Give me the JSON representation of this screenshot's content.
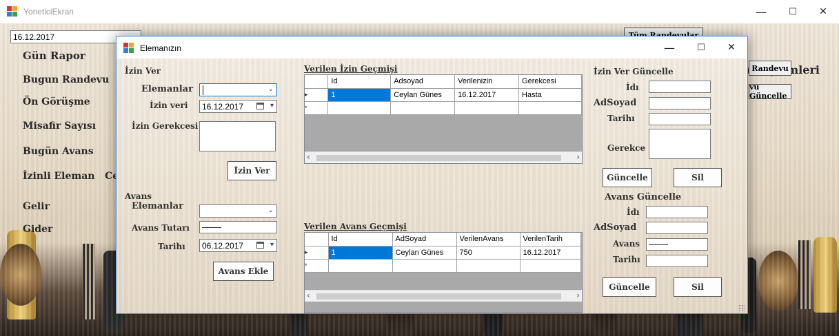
{
  "main_window": {
    "title": "YoneticiEkran",
    "minimize": "—",
    "maximize": "☐",
    "close": "✕",
    "date_value": "16.12.2017",
    "top_button": "Tüm Randevular",
    "right_heading": "vu İşlemleri",
    "right_button_1": "Randevu",
    "right_button_2": "vu Güncelle",
    "sidebar": [
      "Gün Rapor",
      "Bugun Randevu",
      "Ön Görüşme",
      "Misafir Sayısı",
      "Bugün Avans",
      "İzinli Eleman   Cey",
      "Gelir",
      "Gider"
    ]
  },
  "dialog": {
    "title": "Elemanızın",
    "minimize": "—",
    "maximize": "☐",
    "close": "✕",
    "izin": {
      "heading": "İzin Ver",
      "elemanlar_label": "Elemanlar",
      "elemanlar_value": "",
      "izin_veri_label": "İzin veri",
      "izin_veri_value": "16.12.2017",
      "gerekce_label": "İzin Gerekcesi",
      "gerekce_value": "",
      "button": "İzin Ver"
    },
    "avans": {
      "heading": "Avans",
      "elemanlar_label": "Elemanlar",
      "elemanlar_value": "",
      "tutar_label": "Avans Tutarı",
      "tutar_value": "",
      "tarih_label": "Tarihı",
      "tarih_value": "06.12.2017",
      "button": "Avans Ekle"
    },
    "izin_grid": {
      "title": "Verilen İzin Geçmişi",
      "columns": [
        "Id",
        "Adsoyad",
        "Verilenizin",
        "Gerekcesi"
      ],
      "rows": [
        [
          "1",
          "Ceylan Günes",
          "16.12.2017",
          "Hasta"
        ]
      ]
    },
    "avans_grid": {
      "title": "Verilen Avans Geçmişi",
      "columns": [
        "Id",
        "AdSoyad",
        "VerilenAvans",
        "VerilenTarih"
      ],
      "rows": [
        [
          "1",
          "Ceylan Günes",
          "750",
          "16.12.2017"
        ]
      ]
    },
    "izin_update": {
      "heading": "İzin Ver Güncelle",
      "id_label": "İdı",
      "adsoyad_label": "AdSoyad",
      "tarih_label": "Tarihı",
      "gerekce_label": "Gerekce",
      "update_button": "Güncelle",
      "delete_button": "Sil"
    },
    "avans_update": {
      "heading": "Avans Güncelle",
      "id_label": "İdı",
      "adsoyad_label": "AdSoyad",
      "avans_label": "Avans",
      "tarih_label": "Tarihı",
      "update_button": "Güncelle",
      "delete_button": "Sil"
    },
    "row_indicator": "▸",
    "new_row_indicator": "*"
  }
}
